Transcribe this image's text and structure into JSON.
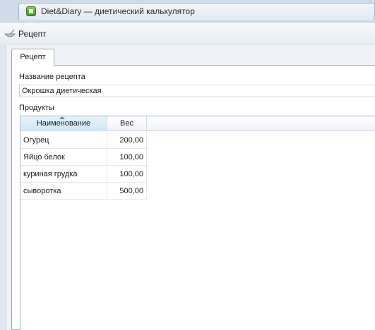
{
  "app": {
    "title": "Diet&Diary — диетический калькулятор"
  },
  "child_window": {
    "title": "Рецепт"
  },
  "tabs": [
    {
      "label": "Рецепт",
      "active": true
    }
  ],
  "form": {
    "name_label": "Название рецепта",
    "name_value": "Окрошка диетическая",
    "products_label": "Продукты"
  },
  "grid": {
    "columns": [
      "Наименование",
      "Вес"
    ],
    "sorted_column": "Наименование",
    "rows": [
      {
        "name": "Огурец",
        "weight": "200,00"
      },
      {
        "name": "Яйцо белок",
        "weight": "100,00"
      },
      {
        "name": "куриная грудка",
        "weight": "100,00"
      },
      {
        "name": "сыворотка",
        "weight": "500,00"
      }
    ]
  },
  "colors": {
    "frame": "#cfdbe8",
    "selected_header": "#cfe6f7",
    "app_icon": "#3e9a1c"
  },
  "icons": {
    "app": "diet-diary-app-icon",
    "child": "recipe-bowl-icon",
    "sort": "sort-ascending-icon"
  }
}
